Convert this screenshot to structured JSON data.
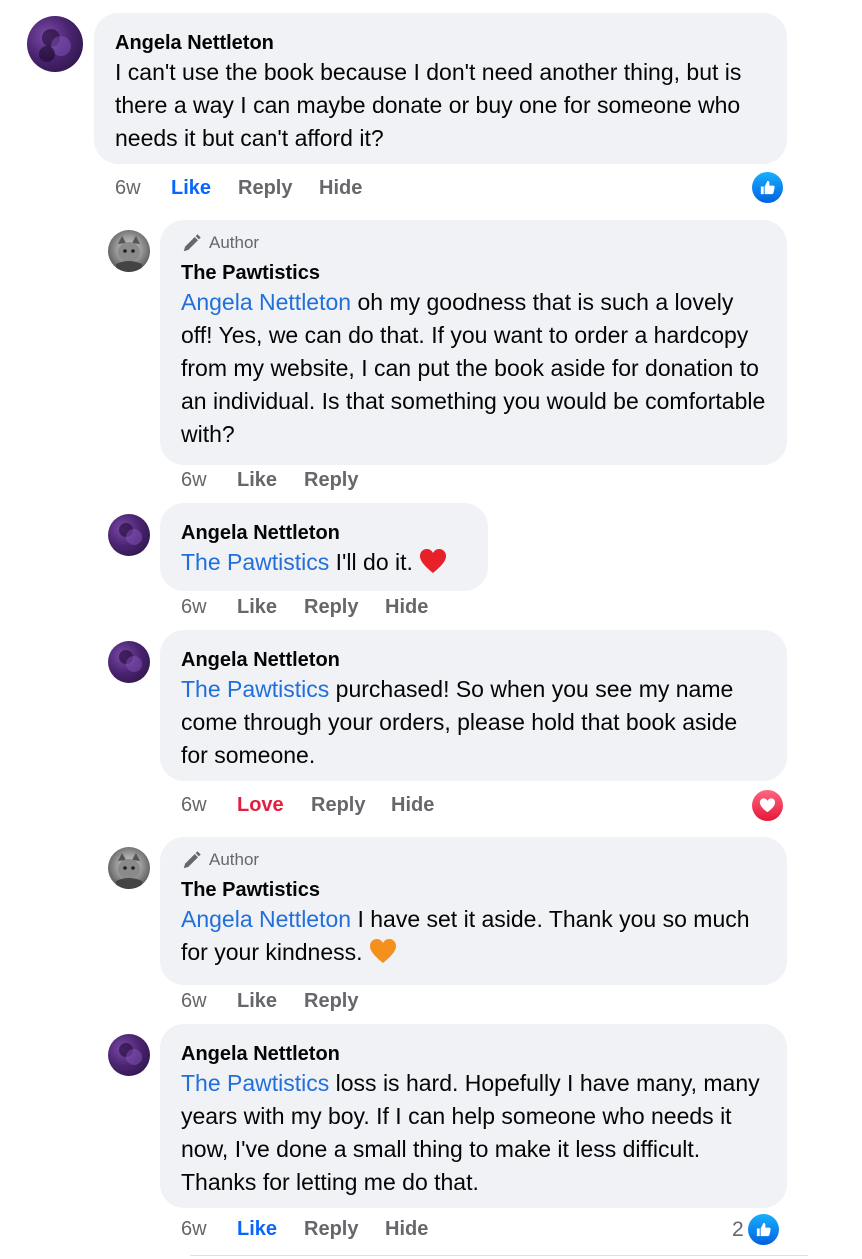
{
  "comments": [
    {
      "author": "Angela Nettleton",
      "is_author": false,
      "mention": "",
      "text": "I can't use the book because I don't need another thing, but is there a way I can maybe donate or buy one for someone who needs it but can't afford it?",
      "time": "6w",
      "actions": [
        "Like",
        "Reply",
        "Hide"
      ],
      "reaction": {
        "type": "like",
        "count": ""
      }
    },
    {
      "author": "The Pawtistics",
      "is_author": true,
      "badge": "Author",
      "mention": "Angela Nettleton",
      "text": " oh my goodness that is such a lovely off! Yes, we can do that. If you want to order a hardcopy from my website, I can put the book aside for donation to an individual. Is that something you would be comfortable with?",
      "time": "6w",
      "actions": [
        "Like",
        "Reply"
      ]
    },
    {
      "author": "Angela Nettleton",
      "is_author": false,
      "mention": "The Pawtistics",
      "text": " I'll do it. ",
      "emoji": "red-heart",
      "time": "6w",
      "actions": [
        "Like",
        "Reply",
        "Hide"
      ]
    },
    {
      "author": "Angela Nettleton",
      "is_author": false,
      "mention": "The Pawtistics",
      "text": " purchased! So when you see my name come through your orders, please hold that book aside for someone.",
      "time": "6w",
      "actions": [
        "Love",
        "Reply",
        "Hide"
      ],
      "reaction": {
        "type": "love",
        "count": ""
      }
    },
    {
      "author": "The Pawtistics",
      "is_author": true,
      "badge": "Author",
      "mention": "Angela Nettleton",
      "text": " I have set it aside. Thank you so much for your kindness. ",
      "emoji": "orange-heart",
      "time": "6w",
      "actions": [
        "Like",
        "Reply"
      ]
    },
    {
      "author": "Angela Nettleton",
      "is_author": false,
      "mention": "The Pawtistics",
      "text": " loss is hard. Hopefully I have many, many years with my boy. If I can help someone who needs it now, I've done a small thing to make it less difficult. Thanks for letting me do that.",
      "time": "6w",
      "actions": [
        "Like",
        "Reply",
        "Hide"
      ],
      "reaction": {
        "type": "like",
        "count": "2"
      }
    }
  ],
  "colors": {
    "bubble": "#f0f2f5",
    "mention": "#216fdb",
    "like_active": "#0866ff",
    "love_active": "#e41e3f",
    "meta": "#65676b"
  }
}
